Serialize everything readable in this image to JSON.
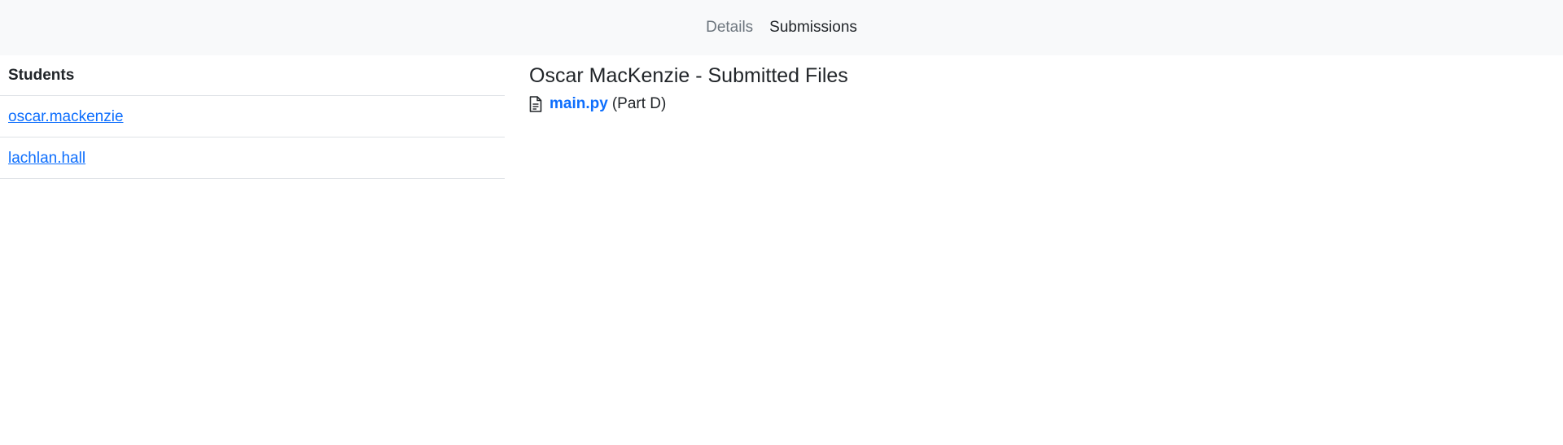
{
  "nav": {
    "tabs": [
      {
        "label": "Details",
        "active": false
      },
      {
        "label": "Submissions",
        "active": true
      }
    ]
  },
  "students": {
    "header": "Students",
    "items": [
      {
        "username": "oscar.mackenzie"
      },
      {
        "username": "lachlan.hall"
      }
    ]
  },
  "content": {
    "title": "Oscar MacKenzie - Submitted Files",
    "files": [
      {
        "name": "main.py",
        "part": "(Part D)",
        "icon": "file-text-icon"
      }
    ]
  },
  "colors": {
    "link": "#0d6efd",
    "nav_background": "#f8f9fa",
    "inactive_tab": "#6c757d",
    "border": "#dee2e6"
  }
}
